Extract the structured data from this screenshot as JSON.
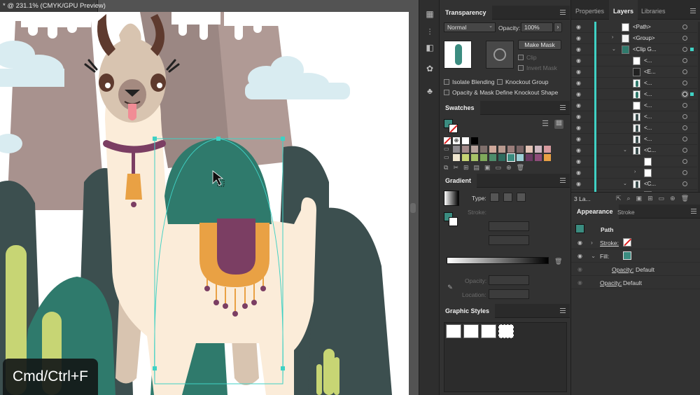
{
  "document": {
    "tab_title": "* @ 231.1% (CMYK/GPU Preview)"
  },
  "overlay": {
    "shortcut_text": "Cmd/Ctrl+F"
  },
  "transparency": {
    "tab_label": "Transparency",
    "blend_mode": "Normal",
    "opacity_label": "Opacity:",
    "opacity_value": "100%",
    "make_mask_label": "Make Mask",
    "clip_label": "Clip",
    "invert_mask_label": "Invert Mask",
    "isolate_blending_label": "Isolate Blending",
    "knockout_group_label": "Knockout Group",
    "opacity_mask_label": "Opacity & Mask Define Knockout Shape"
  },
  "swatches": {
    "tab_label": "Swatches",
    "row1": [
      "none",
      "registration",
      "#ffffff",
      "#000000"
    ],
    "row2": [
      "folder",
      "#8e8b8f",
      "#a38a8a",
      "#b7a39d",
      "#7f6f6b",
      "#cfa89a",
      "#b89a8f",
      "#9a7d7a",
      "#7b6566",
      "#e3c3b6",
      "#cfb7c0",
      "#d79a9e"
    ],
    "row3": [
      "folder",
      "#efe6cf",
      "#c7d574",
      "#a7c468",
      "#7fa95b",
      "#4e8c6b",
      "#2f6b5e",
      "#3b8c80",
      "#9ccfd6",
      "#6b3a63",
      "#8e4c7a",
      "#e8a044"
    ],
    "selected_fill": "#3b8c80"
  },
  "gradient": {
    "tab_label": "Gradient",
    "type_label": "Type:",
    "stroke_label": "Stroke:",
    "opacity_label": "Opacity:",
    "location_label": "Location:"
  },
  "graphic_styles": {
    "tab_label": "Graphic Styles"
  },
  "layers_panel": {
    "tabs": [
      "Properties",
      "Layers",
      "Libraries"
    ],
    "active_tab": "Layers",
    "rows": [
      {
        "name": "<Path>",
        "indent": 0,
        "expander": "",
        "thumb": "white"
      },
      {
        "name": "<Group>",
        "indent": 0,
        "expander": "›",
        "thumb": "red"
      },
      {
        "name": "<Clip G...",
        "indent": 0,
        "expander": "⌄",
        "thumb": "teal",
        "selected": true
      },
      {
        "name": "<...",
        "indent": 1,
        "expander": "",
        "thumb": "white"
      },
      {
        "name": "<E...",
        "indent": 1,
        "expander": "",
        "thumb": "black"
      },
      {
        "name": "<...",
        "indent": 1,
        "expander": "",
        "thumb": "teal-shape"
      },
      {
        "name": "<...",
        "indent": 1,
        "expander": "",
        "thumb": "teal-shape",
        "target_selected": true
      },
      {
        "name": "<...",
        "indent": 1,
        "expander": "",
        "thumb": "white"
      },
      {
        "name": "<...",
        "indent": 1,
        "expander": "",
        "thumb": "dark"
      },
      {
        "name": "<...",
        "indent": 1,
        "expander": "",
        "thumb": "dark"
      },
      {
        "name": "<...",
        "indent": 1,
        "expander": "",
        "thumb": "dark"
      },
      {
        "name": "<C...",
        "indent": 1,
        "expander": "⌄",
        "thumb": "dark"
      },
      {
        "name": "",
        "indent": 2,
        "expander": "",
        "thumb": "white"
      },
      {
        "name": "",
        "indent": 2,
        "expander": "›",
        "thumb": "white"
      },
      {
        "name": "<C...",
        "indent": 1,
        "expander": "⌄",
        "thumb": "dark"
      },
      {
        "name": "",
        "indent": 2,
        "expander": "",
        "thumb": "white"
      }
    ],
    "footer_label": "3 La..."
  },
  "appearance": {
    "tabs": [
      "Appearance",
      "Stroke"
    ],
    "active_tab": "Appearance",
    "object_label": "Path",
    "stroke_label": "Stroke:",
    "fill_label": "Fill:",
    "fill_opacity_label": "Opacity:",
    "fill_opacity_value": "Default",
    "opacity_label": "Opacity:",
    "opacity_value": "Default"
  },
  "colors": {
    "teal": "#2f7a6c",
    "teal_dark": "#2a5c56",
    "slate": "#3c4f4f",
    "cream": "#fbecd9",
    "tan": "#d8c4b0",
    "brown": "#5e3a2e",
    "plum": "#7b3e63",
    "orange": "#e9a144",
    "cactus": "#c7d574",
    "cloud": "#d9ecf1",
    "selection": "#3fd1c4"
  },
  "tools": [
    "libraries-icon",
    "align-icon",
    "pathfinder-icon",
    "symbols-icon",
    "brushes-icon"
  ]
}
